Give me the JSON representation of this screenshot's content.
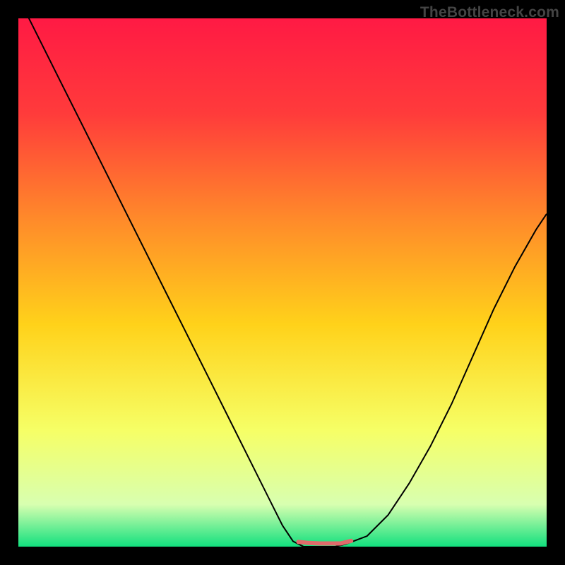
{
  "watermark": "TheBottleneck.com",
  "chart_data": {
    "type": "line",
    "title": "",
    "xlabel": "",
    "ylabel": "",
    "xlim": [
      0,
      100
    ],
    "ylim": [
      0,
      100
    ],
    "gradient_stops": [
      {
        "offset": 0,
        "color": "#ff1a44"
      },
      {
        "offset": 18,
        "color": "#ff3b3b"
      },
      {
        "offset": 38,
        "color": "#ff8a2a"
      },
      {
        "offset": 58,
        "color": "#ffd21a"
      },
      {
        "offset": 78,
        "color": "#f6ff66"
      },
      {
        "offset": 92,
        "color": "#d8ffb0"
      },
      {
        "offset": 100,
        "color": "#12e07e"
      }
    ],
    "series": [
      {
        "name": "bottleneck-curve",
        "color": "#000000",
        "width": 2,
        "x": [
          0,
          4,
          8,
          12,
          16,
          20,
          24,
          28,
          32,
          36,
          40,
          44,
          48,
          50,
          52,
          54,
          56,
          58,
          60,
          62,
          66,
          70,
          74,
          78,
          82,
          86,
          90,
          94,
          98,
          100
        ],
        "values": [
          104,
          96,
          88,
          80,
          72,
          64,
          56,
          48,
          40,
          32,
          24,
          16,
          8,
          4,
          1,
          0,
          0,
          0,
          0,
          0.5,
          2,
          6,
          12,
          19,
          27,
          36,
          45,
          53,
          60,
          63
        ]
      },
      {
        "name": "flat-marker",
        "color": "#e06b6b",
        "width": 6,
        "cap": "round",
        "x": [
          53,
          55,
          57,
          59,
          61,
          63
        ],
        "values": [
          0.9,
          0.7,
          0.6,
          0.6,
          0.6,
          1.1
        ]
      }
    ]
  }
}
